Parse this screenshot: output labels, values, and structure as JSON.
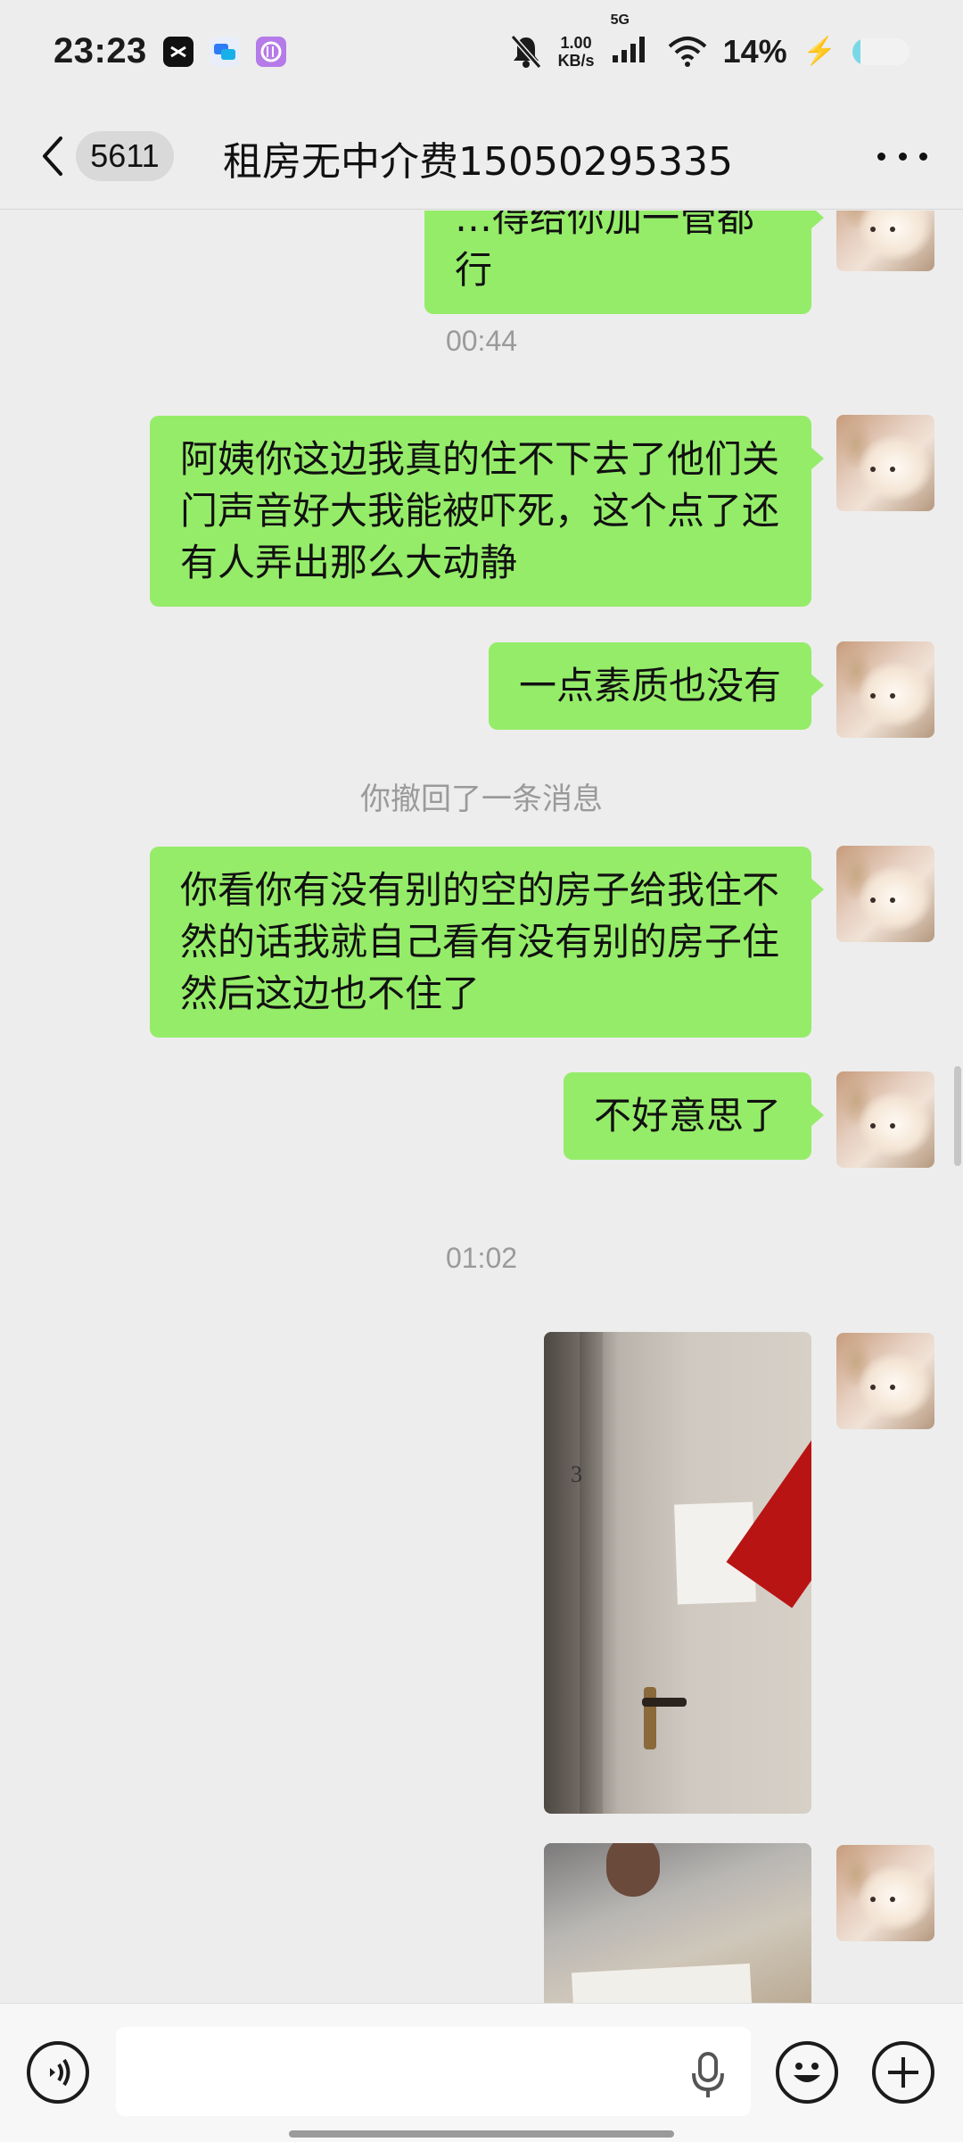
{
  "status_bar": {
    "time": "23:23",
    "net_speed_value": "1.00",
    "net_speed_unit": "KB/s",
    "network_type": "5G",
    "battery_percent": "14%",
    "battery_level": 0.14,
    "icons": [
      "capcut-icon",
      "messenger-app-icon",
      "purple-app-icon",
      "mute-bell-icon",
      "signal-icon",
      "wifi-icon",
      "charging-bolt-icon",
      "battery-icon"
    ]
  },
  "header": {
    "unread_count": "5611",
    "title": "租房无中介费15050295335",
    "icons": [
      "back-arrow-icon",
      "more-options-icon"
    ]
  },
  "messages": {
    "cut_off_top_text": "…得给你加一管都行",
    "ts1": "00:44",
    "m1": "阿姨你这边我真的住不下去了他们关门声音好大我能被吓死，这个点了还有人弄出那么大动静",
    "m2": "一点素质也没有",
    "recall_notice": "你撤回了一条消息",
    "m3": "你看你有没有别的空的房子给我住不然的话我就自己看有没有别的房子住然后这边也不住了",
    "m4": "不好意思了",
    "ts2": "01:02",
    "photo1_door_number": "3"
  },
  "input_bar": {
    "placeholder": "",
    "icons": [
      "voice-input-icon",
      "microphone-icon",
      "emoji-icon",
      "plus-icon"
    ]
  }
}
